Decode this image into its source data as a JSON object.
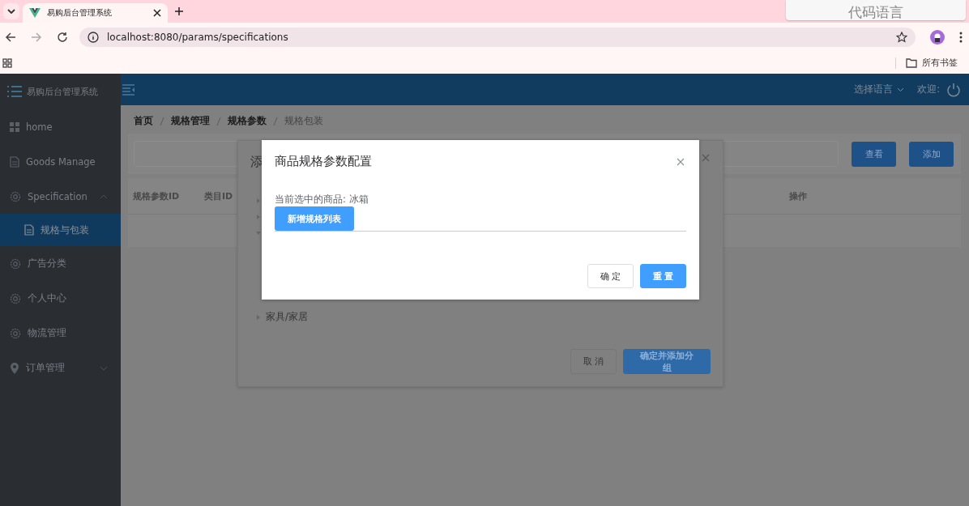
{
  "browser": {
    "tab_title": "易购后台管理系统",
    "url": "localhost:8080/params/specifications",
    "bookmarks_folder": "所有书签",
    "popup_text": "代码语言"
  },
  "app": {
    "logo_text": "易购后台管理系统",
    "language_menu": "选择语言",
    "welcome": "欢迎:"
  },
  "sidebar": {
    "items": [
      {
        "label": "home"
      },
      {
        "label": "Goods Manage"
      },
      {
        "label": "Specification",
        "expanded": true,
        "has_arrow": true,
        "children": [
          {
            "label": "规格与包装",
            "selected": true
          }
        ]
      },
      {
        "label": "广告分类"
      },
      {
        "label": "个人中心"
      },
      {
        "label": "物流管理"
      },
      {
        "label": "订单管理",
        "expanded": false,
        "has_arrow": true
      }
    ]
  },
  "breadcrumb": [
    {
      "label": "首页",
      "current": false
    },
    {
      "label": "规格管理",
      "current": false
    },
    {
      "label": "规格参数",
      "current": false
    },
    {
      "label": "规格包装",
      "current": true
    }
  ],
  "toolbar": {
    "buttons": [
      "查看",
      "添加"
    ]
  },
  "table": {
    "columns": [
      "规格参数ID",
      "类目ID",
      "操作"
    ]
  },
  "back_dialog": {
    "title": "添",
    "tree": [
      {
        "expanded": false
      },
      {
        "expanded": false
      },
      {
        "expanded": true
      }
    ],
    "tree_last": "家具/家居",
    "buttons": [
      {
        "label": "取 消",
        "primary": false
      },
      {
        "label": "确定并添加分组",
        "primary": true
      }
    ]
  },
  "modal": {
    "title": "商品规格参数配置",
    "current_goods": "当前选中的商品: 冰箱",
    "add_button": "新增规格列表",
    "buttons": [
      {
        "label": "确 定",
        "primary": false
      },
      {
        "label": "重 置",
        "primary": true
      }
    ]
  }
}
